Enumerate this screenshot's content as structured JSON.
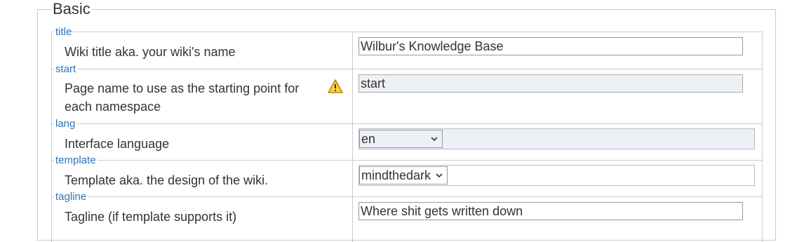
{
  "section": {
    "legend": "Basic"
  },
  "rows": [
    {
      "key": "title",
      "description": "Wiki title aka. your wiki's name",
      "value": "Wilbur's Knowledge Base"
    },
    {
      "key": "start",
      "description_line1": "Page name to use as the starting point for",
      "description_line2": "each namespace",
      "value": "start",
      "warning": "warning-icon"
    },
    {
      "key": "lang",
      "description": "Interface language",
      "value": "en"
    },
    {
      "key": "template",
      "description": "Template aka. the design of the wiki.",
      "value": "mindthedark"
    },
    {
      "key": "tagline",
      "description": "Tagline (if template supports it)",
      "value": "Where shit gets written down"
    }
  ]
}
